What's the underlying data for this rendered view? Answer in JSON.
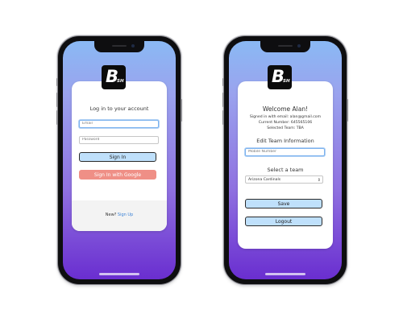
{
  "login_screen": {
    "logo": {
      "letter": "B",
      "subscript": "SH"
    },
    "title": "Log in to your account",
    "email_input": {
      "placeholder": "Email",
      "value": ""
    },
    "password_input": {
      "placeholder": "Password",
      "value": ""
    },
    "sign_in_label": "Sign In",
    "google_sign_in_label": "Sign In with Google",
    "footer": {
      "prompt": "New?",
      "signup_link": "Sign Up"
    }
  },
  "profile_screen": {
    "logo": {
      "letter": "B",
      "subscript": "SH"
    },
    "welcome": "Welcome Alan!",
    "signed_in_line": "Signed in with email: alan@gmail.com",
    "current_number_line": "Current Number: 645565106",
    "selected_team_line": "Selected Team: TBA",
    "edit_heading": "Edit Team Information",
    "mobile_input": {
      "placeholder": "Mobile Number",
      "value": ""
    },
    "select_team_heading": "Select a team",
    "team_select": {
      "selected": "Arizona Cardinals"
    },
    "save_label": "Save",
    "logout_label": "Logout"
  },
  "colors": {
    "gradient_top": "#8ab9f4",
    "gradient_bottom": "#6a2ed0",
    "primary_button": "#bfe0fb",
    "google_button": "#ef8f86",
    "link": "#3b82d6"
  },
  "icons": [
    "brand-logo-icon",
    "chevron-updown-icon"
  ]
}
